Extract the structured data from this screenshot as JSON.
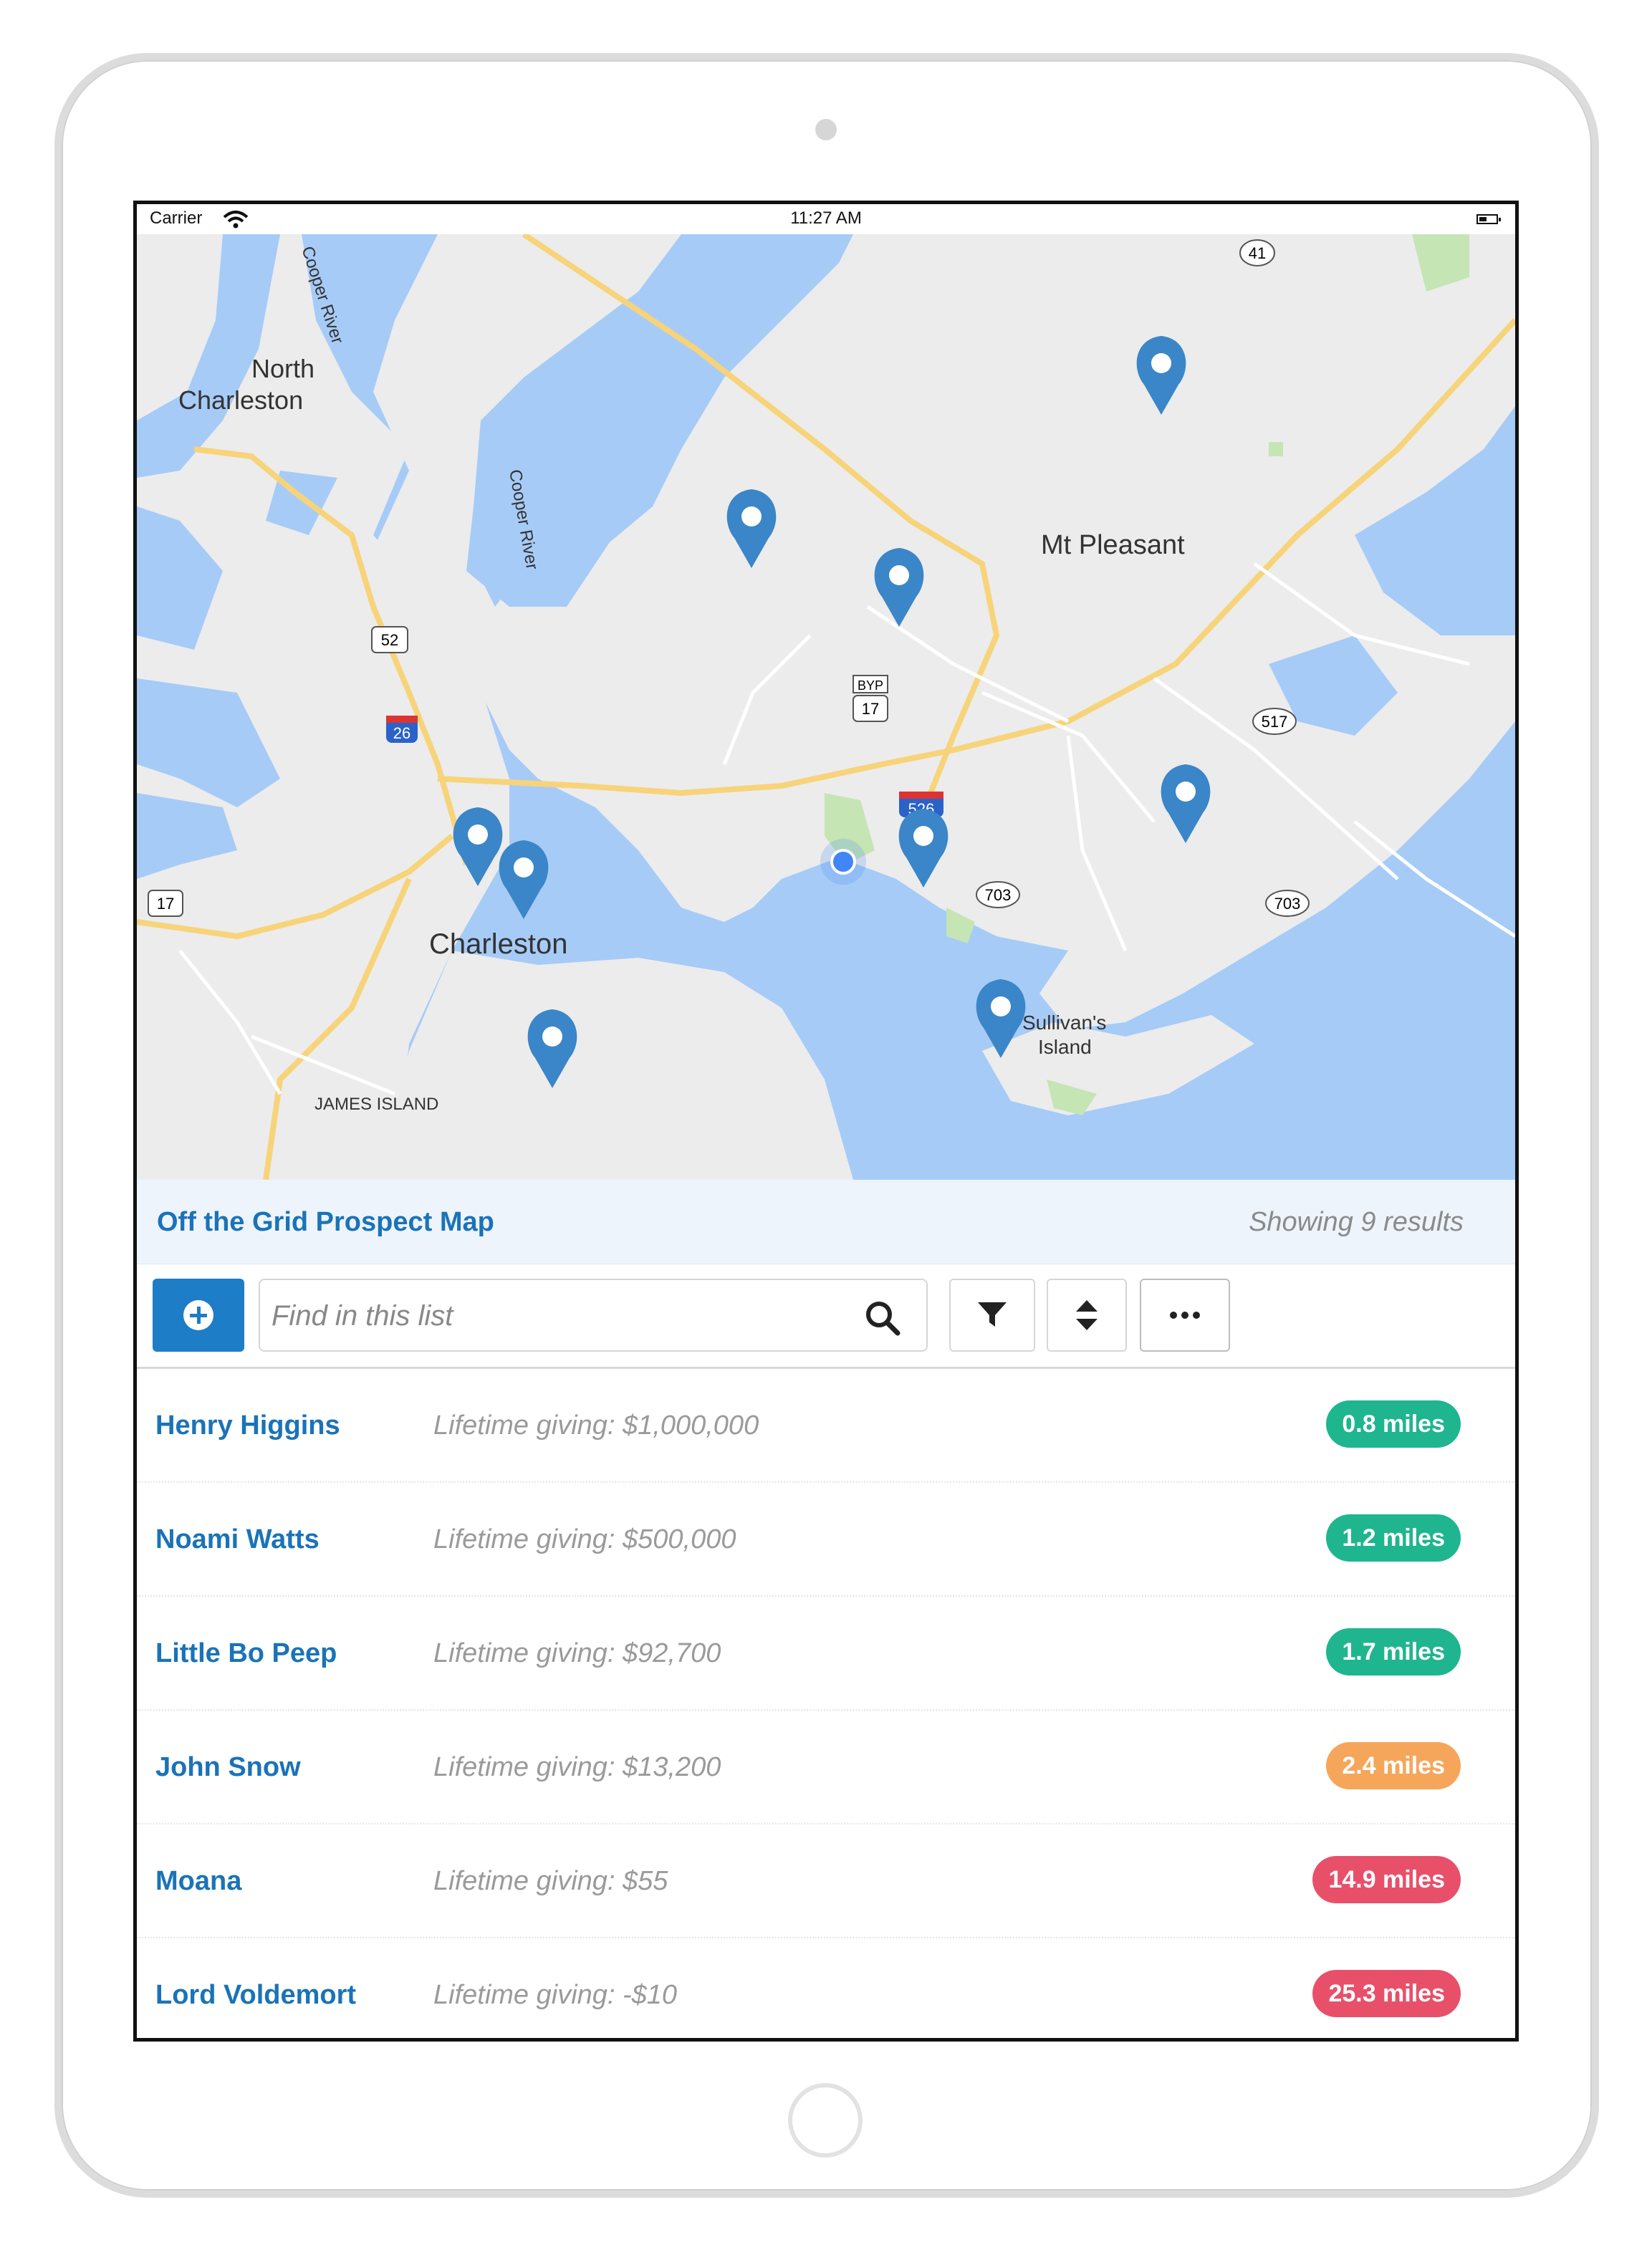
{
  "status_bar": {
    "carrier": "Carrier",
    "time": "11:27 AM"
  },
  "map": {
    "labels": {
      "north_charleston": [
        "North",
        "Charleston"
      ],
      "charleston": "Charleston",
      "mt_pleasant": "Mt Pleasant",
      "sullivans_island": [
        "Sullivan's",
        "Island"
      ],
      "james_island": "JAMES ISLAND",
      "cooper_river_1": "Cooper River",
      "cooper_river_2": "Cooper River"
    },
    "route_shields": {
      "r41": "41",
      "r52": "52",
      "r26": "26",
      "byp": "BYP",
      "r17a": "17",
      "r517": "517",
      "r526": "526",
      "r703a": "703",
      "r703b": "703",
      "r17b": "17"
    },
    "pin_color": "#3a86c8",
    "current_location_color": "#4285f4",
    "water_color": "#a6cbf7",
    "land_color": "#ececec"
  },
  "list_header": {
    "title": "Off the Grid Prospect Map",
    "result_count": "Showing 9 results"
  },
  "toolbar": {
    "add_icon": "plus-circle-icon",
    "search_placeholder": "Find in this list",
    "search_icon": "search-icon",
    "filter_icon": "filter-icon",
    "sort_icon": "sort-icon",
    "more_icon": "ellipsis-icon"
  },
  "prospects": [
    {
      "name": "Henry Higgins",
      "giving": "Lifetime giving: $1,000,000",
      "distance": "0.8 miles",
      "color": "#1fb58f"
    },
    {
      "name": "Noami Watts",
      "giving": "Lifetime giving: $500,000",
      "distance": "1.2 miles",
      "color": "#1fb58f"
    },
    {
      "name": "Little Bo Peep",
      "giving": "Lifetime giving: $92,700",
      "distance": "1.7 miles",
      "color": "#1fb58f"
    },
    {
      "name": "John Snow",
      "giving": "Lifetime giving: $13,200",
      "distance": "2.4 miles",
      "color": "#f5a65b"
    },
    {
      "name": "Moana",
      "giving": "Lifetime giving: $55",
      "distance": "14.9 miles",
      "color": "#e8506a"
    },
    {
      "name": "Lord Voldemort",
      "giving": "Lifetime giving: -$10",
      "distance": "25.3 miles",
      "color": "#e8506a"
    }
  ]
}
